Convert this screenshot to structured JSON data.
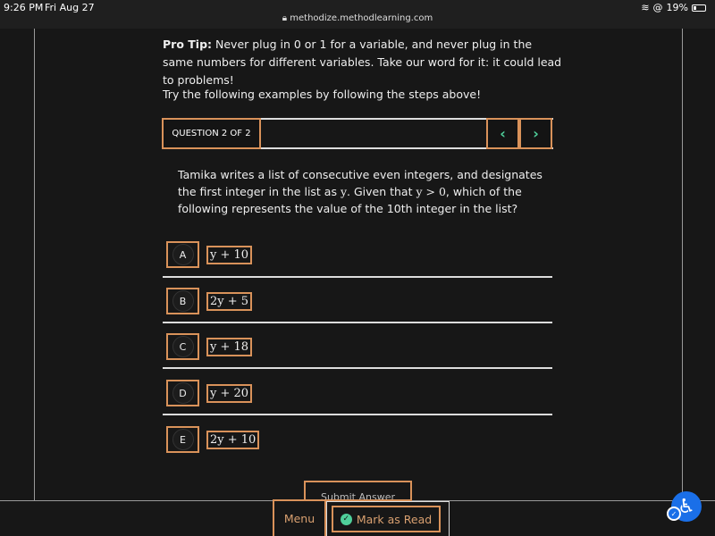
{
  "status_bar": {
    "time": "9:26 PM",
    "date": "Fri Aug 27",
    "battery": "19%",
    "url": "methodize.methodlearning.com"
  },
  "content": {
    "pro_tip_label": "Pro Tip:",
    "pro_tip_text": " Never plug in 0 or 1 for a variable, and never plug in the same numbers for different variables. Take our word for it: it could lead to problems!",
    "instruction": "Try the following examples by following the steps above!"
  },
  "question": {
    "counter": "QUESTION 2 OF 2",
    "prev_icon": "chevron-left",
    "next_icon": "chevron-right",
    "text_1": "Tamika writes a list of consecutive even integers, and designates the first integer in the list as ",
    "var": "y",
    "text_2": ". Given that ",
    "cond": "y > 0",
    "text_3": ", which of the following represents the value of the 10th integer in the list?",
    "options": [
      {
        "letter": "A",
        "answer": "y + 10"
      },
      {
        "letter": "B",
        "answer": "2y + 5"
      },
      {
        "letter": "C",
        "answer": "y + 18"
      },
      {
        "letter": "D",
        "answer": "y + 20"
      },
      {
        "letter": "E",
        "answer": "2y + 10"
      }
    ],
    "submit_label": "Submit Answer"
  },
  "footer": {
    "menu_label": "Menu",
    "mark_read_label": "Mark as Read"
  },
  "colors": {
    "accent": "#d9925a",
    "nav_arrow": "#4fcf9a",
    "accessibility": "#1a6fe8"
  }
}
